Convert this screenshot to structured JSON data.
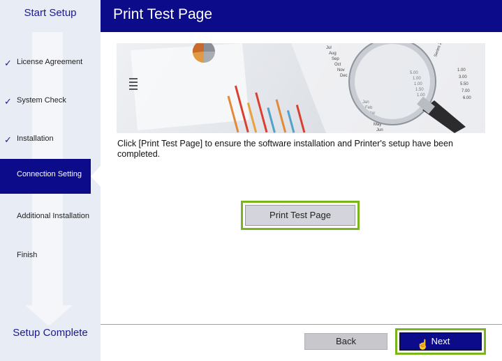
{
  "header": {
    "title": "Print Test Page"
  },
  "sidebar": {
    "title": "Start Setup",
    "footer": "Setup Complete",
    "steps": [
      {
        "label": "License Agreement",
        "done": true
      },
      {
        "label": "System Check",
        "done": true
      },
      {
        "label": "Installation",
        "done": true
      },
      {
        "label": "Connection Setting",
        "active": true
      },
      {
        "label": "Additional Installation"
      },
      {
        "label": "Finish"
      }
    ],
    "check_glyph": "✓"
  },
  "main": {
    "instruction": "Click [Print Test Page] to ensure the software installation and Printer's setup have been completed.",
    "print_button_label": "Print Test Page"
  },
  "footer": {
    "back_label": "Back",
    "next_label": "Next"
  },
  "hero_text": {
    "months": [
      "Jul",
      "Aug",
      "Sep",
      "Oct",
      "Nov",
      "Dec"
    ],
    "months2": [
      "Jan",
      "Feb",
      "Mar",
      "Apr",
      "May",
      "Jun"
    ],
    "series_label": "Series 2",
    "values": [
      "5.00",
      "1.00",
      "1.00",
      "1.50",
      "1.00",
      "1.00",
      "3.00",
      "5.50",
      "7.00",
      "6.00"
    ]
  },
  "colors": {
    "accent": "#0c0c8a",
    "highlight": "#7ab51d"
  }
}
